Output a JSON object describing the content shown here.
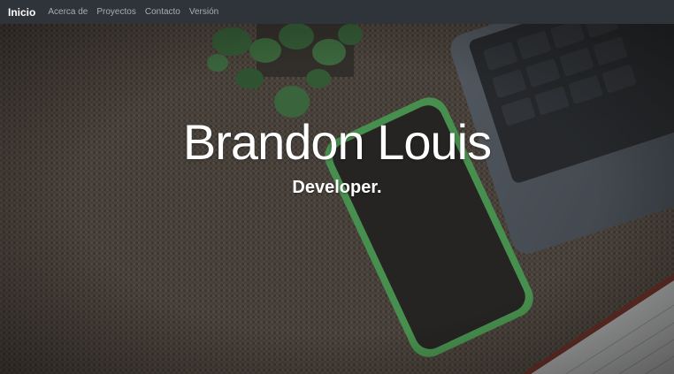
{
  "navbar": {
    "brand": "Inicio",
    "links": [
      "Acerca de",
      "Proyectos",
      "Contacto",
      "Versión"
    ]
  },
  "hero": {
    "title": "Brandon Louis",
    "subtitle": "Developer."
  },
  "colors": {
    "navbar_bg": "#2f343a",
    "brand_text": "#ffffff",
    "link_text": "#a7acb1",
    "phone_accent": "#5ec96a"
  }
}
